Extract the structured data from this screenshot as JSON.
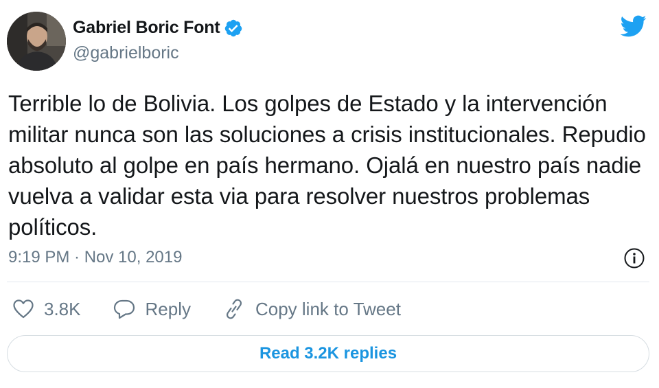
{
  "author": {
    "display_name": "Gabriel Boric Font",
    "handle": "@gabrielboric",
    "verified": true
  },
  "tweet": {
    "text": "Terrible lo de Bolivia. Los golpes de Estado y la intervención militar nunca son las soluciones a crisis institucionales. Repudio absoluto al golpe en país hermano. Ojalá en nuestro país nadie vuelva a validar esta via para resolver nuestros problemas políticos.",
    "timestamp": "9:19 PM · Nov 10, 2019"
  },
  "actions": {
    "like_count": "3.8K",
    "reply_label": "Reply",
    "copy_link_label": "Copy link to Tweet"
  },
  "footer": {
    "read_replies_label": "Read 3.2K replies"
  },
  "colors": {
    "brand": "#1da1f2",
    "link": "#1b95e0",
    "secondary_text": "#657786",
    "primary_text": "#14171a"
  },
  "icons": {
    "brand": "twitter-bird-icon",
    "verified": "verified-badge-icon",
    "info": "info-icon",
    "like": "heart-icon",
    "reply": "speech-bubble-icon",
    "copy_link": "link-icon"
  }
}
